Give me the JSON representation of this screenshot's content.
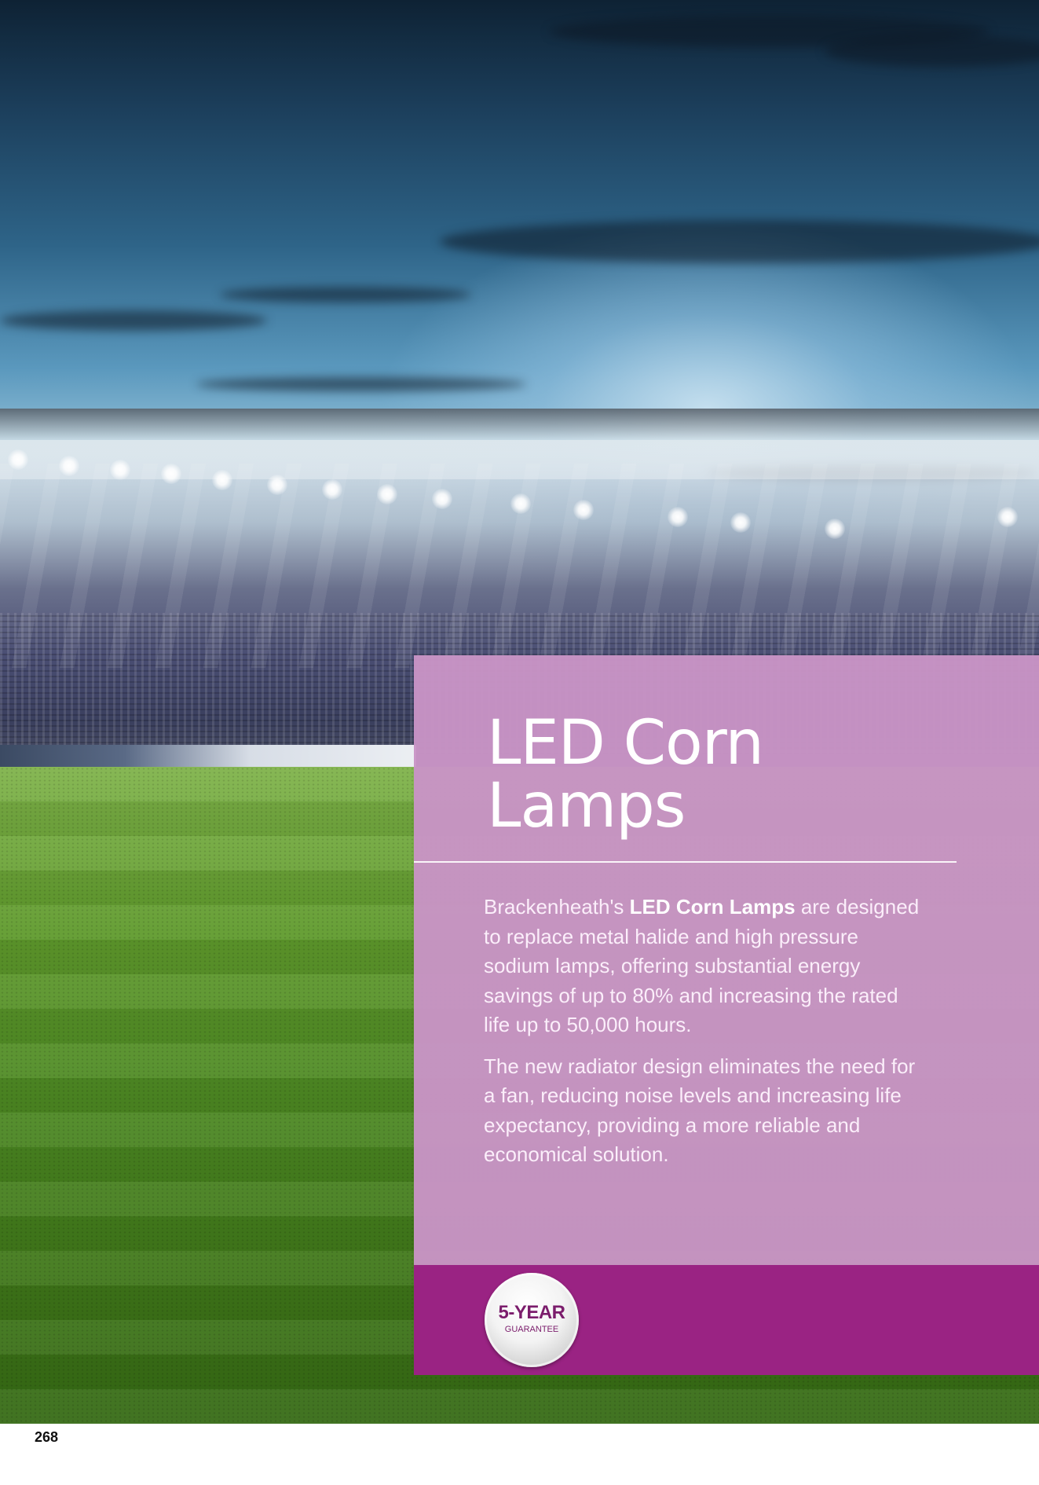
{
  "product": {
    "title_line1": "LED Corn",
    "title_line2": "Lamps"
  },
  "description": {
    "para1_brand": "Brackenheath's",
    "para1_highlight": "LED Corn Lamps",
    "para1_rest": "are designed to replace metal halide and high pressure sodium lamps, offering substantial energy savings of up to 80% and increasing the rated life up to 50,000 hours.",
    "para2": "The new radiator design eliminates the need for a fan, reducing noise levels and increasing life expectancy, providing a more reliable and economical solution."
  },
  "badge": {
    "main": "5-YEAR",
    "sub": "GUARANTEE"
  },
  "page_number": "268",
  "colors": {
    "panel": "#c994c6",
    "strip": "#9a2383",
    "badge_text": "#7b1d6c"
  }
}
